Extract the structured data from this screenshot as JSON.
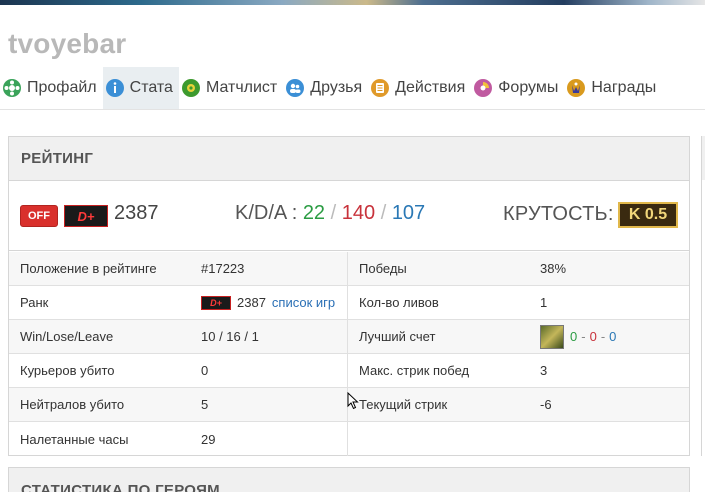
{
  "profile": {
    "username": "tvoyebar"
  },
  "nav": [
    {
      "label": "Профайл",
      "icon": "profile-icon",
      "color": "#3aa35a"
    },
    {
      "label": "Стата",
      "icon": "stats-icon",
      "color": "#3b8fd6",
      "active": true
    },
    {
      "label": "Матчлист",
      "icon": "matchlist-icon",
      "color": "#3d9a2e"
    },
    {
      "label": "Друзья",
      "icon": "friends-icon",
      "color": "#3b8fd6"
    },
    {
      "label": "Действия",
      "icon": "actions-icon",
      "color": "#e09a2a"
    },
    {
      "label": "Форумы",
      "icon": "forums-icon",
      "color": "#c05aa0"
    },
    {
      "label": "Награды",
      "icon": "awards-icon",
      "color": "#d99a1e"
    }
  ],
  "rating": {
    "title": "РЕЙТИНГ",
    "off_label": "OFF",
    "rank_badge": "D+",
    "rating": "2387",
    "kda_label": "K/D/A :",
    "kills": "22",
    "deaths": "140",
    "assists": "107",
    "kda_separator": "/",
    "coolness_label": "КРУТОСТЬ:",
    "coolness_value": "K 0.5"
  },
  "stats": {
    "rows": [
      {
        "label": "Положение в рейтинге",
        "value": "#17223",
        "label2": "Победы",
        "value2": "38%"
      },
      {
        "label": "Ранк",
        "rank_badge": "D+",
        "value": "2387",
        "link": "список игр",
        "label2": "Кол-во ливов",
        "value2": "1"
      },
      {
        "label": "Win/Lose/Leave",
        "value": "10 / 16 / 1",
        "label2": "Лучший счет",
        "best_k": "0",
        "best_d": "0",
        "best_a": "0",
        "best_separator": "-"
      },
      {
        "label": "Курьеров убито",
        "value": "0",
        "label2": "Макс. стрик побед",
        "value2": "3"
      },
      {
        "label": "Нейтралов убито",
        "value": "5",
        "label2": "Текущий стрик",
        "value2": "-6"
      },
      {
        "label": "Налетанные часы",
        "value": "29",
        "label2": "",
        "value2": ""
      }
    ]
  },
  "hero_stats": {
    "title": "СТАТИСТИКА ПО ГЕРОЯМ"
  }
}
